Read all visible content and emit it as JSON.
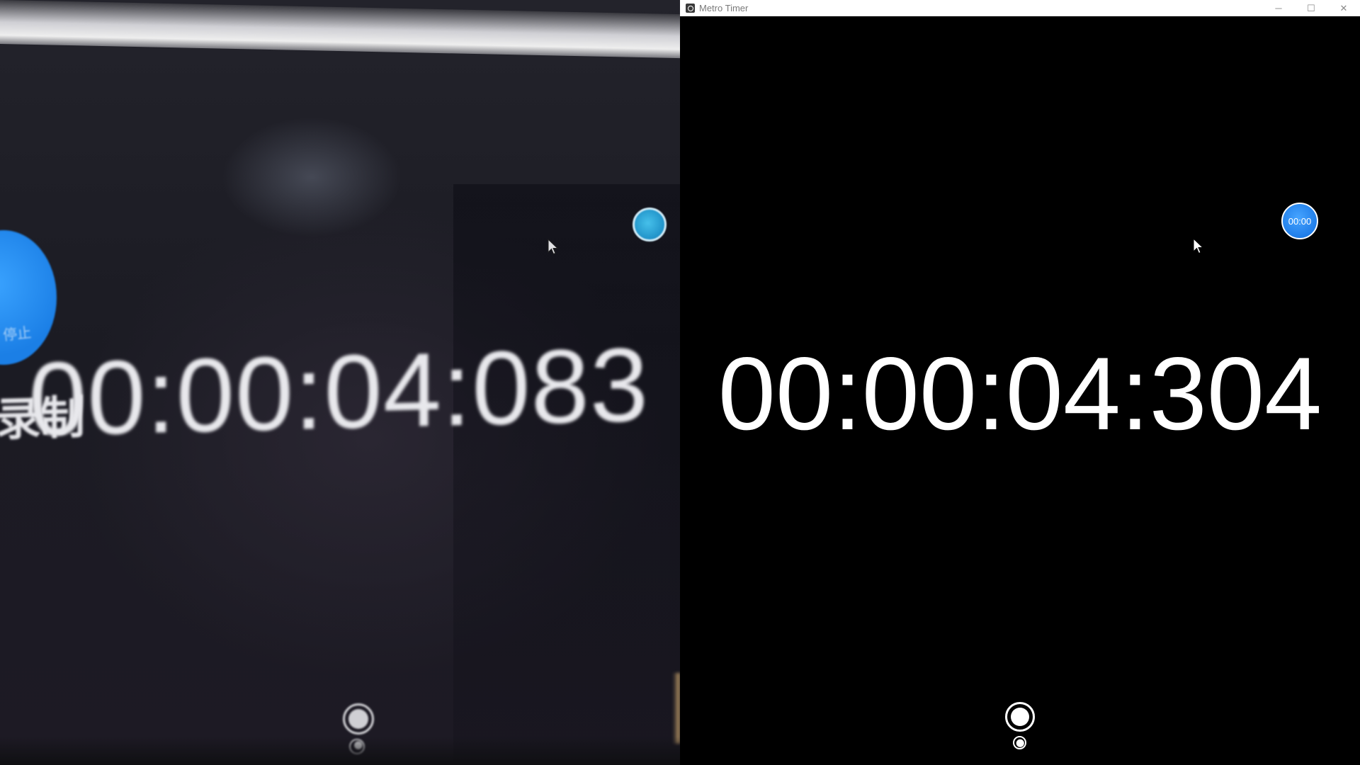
{
  "camera_view": {
    "badge_text": "停止",
    "record_label": "录制",
    "time": "00:00:04:083"
  },
  "window": {
    "title": "Metro Timer",
    "controls": {
      "minimize": "─",
      "maximize": "☐",
      "close": "✕"
    }
  },
  "timer": {
    "badge_label": "00:00",
    "elapsed": "00:00:04:304"
  },
  "colors": {
    "accent_blue": "#1a78e6",
    "background": "#000000",
    "text": "#ffffff"
  },
  "icons": [
    "app-icon",
    "cursor-icon",
    "lap-button-icon",
    "page-indicator-icon"
  ]
}
